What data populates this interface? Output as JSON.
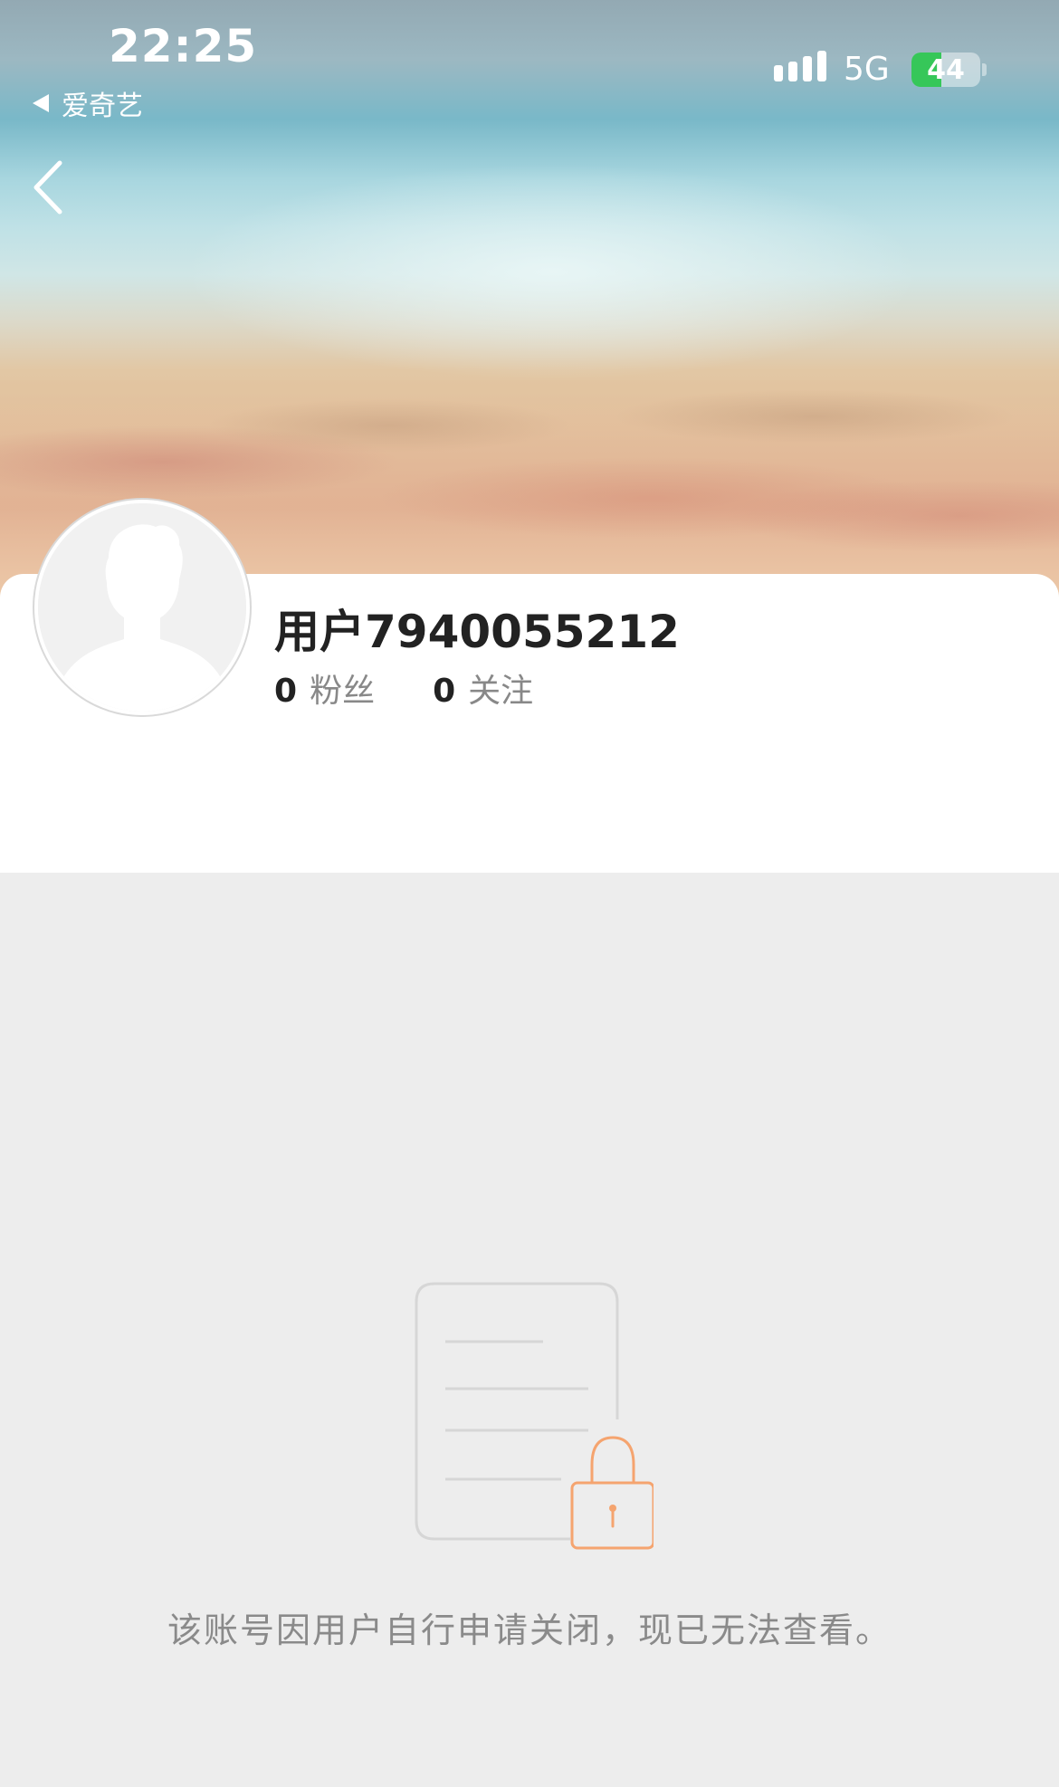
{
  "status_bar": {
    "time": "22:25",
    "back_app_label": "爱奇艺",
    "network": "5G",
    "battery_level": "44",
    "battery_percent": 44,
    "battery_color": "#36c759"
  },
  "nav": {
    "back_icon": "chevron-left-icon"
  },
  "profile": {
    "username": "用户7940055212",
    "followers_count": "0",
    "followers_label": "粉丝",
    "following_count": "0",
    "following_label": "关注"
  },
  "empty_state": {
    "icon": "locked-document-icon",
    "message": "该账号因用户自行申请关闭，现已无法查看。",
    "accent_color": "#f5a46f"
  }
}
